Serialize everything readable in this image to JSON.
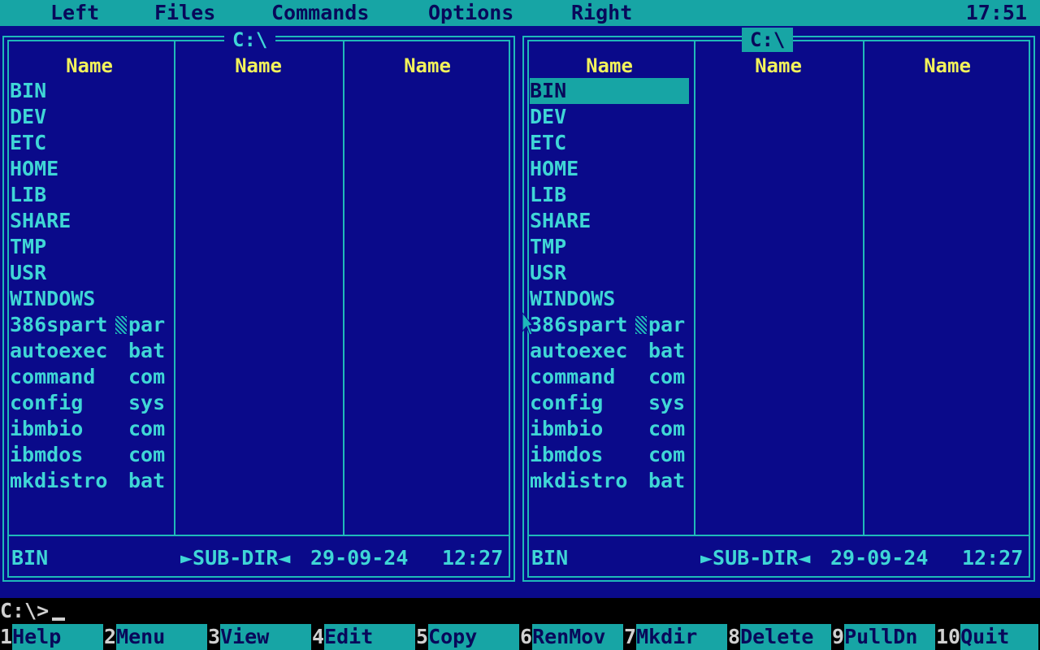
{
  "menu": {
    "items": [
      "Left",
      "Files",
      "Commands",
      "Options",
      "Right"
    ],
    "clock": "17:51"
  },
  "left_panel": {
    "path": "C:\\",
    "column_headers": [
      "Name",
      "Name",
      "Name"
    ],
    "files": [
      {
        "name": "BIN",
        "ext": ""
      },
      {
        "name": "DEV",
        "ext": ""
      },
      {
        "name": "ETC",
        "ext": ""
      },
      {
        "name": "HOME",
        "ext": ""
      },
      {
        "name": "LIB",
        "ext": ""
      },
      {
        "name": "SHARE",
        "ext": ""
      },
      {
        "name": "TMP",
        "ext": ""
      },
      {
        "name": "USR",
        "ext": ""
      },
      {
        "name": "WINDOWS",
        "ext": ""
      },
      {
        "name": "386spart",
        "ext": "par"
      },
      {
        "name": "autoexec",
        "ext": "bat"
      },
      {
        "name": "command",
        "ext": "com"
      },
      {
        "name": "config",
        "ext": "sys"
      },
      {
        "name": "ibmbio",
        "ext": "com"
      },
      {
        "name": "ibmdos",
        "ext": "com"
      },
      {
        "name": "mkdistro",
        "ext": "bat"
      }
    ],
    "status": {
      "name": "BIN",
      "type": "►SUB-DIR◄",
      "date": "29-09-24",
      "time": "12:27"
    }
  },
  "right_panel": {
    "path": "C:\\",
    "column_headers": [
      "Name",
      "Name",
      "Name"
    ],
    "files": [
      {
        "name": "BIN",
        "ext": ""
      },
      {
        "name": "DEV",
        "ext": ""
      },
      {
        "name": "ETC",
        "ext": ""
      },
      {
        "name": "HOME",
        "ext": ""
      },
      {
        "name": "LIB",
        "ext": ""
      },
      {
        "name": "SHARE",
        "ext": ""
      },
      {
        "name": "TMP",
        "ext": ""
      },
      {
        "name": "USR",
        "ext": ""
      },
      {
        "name": "WINDOWS",
        "ext": ""
      },
      {
        "name": "386spart",
        "ext": "par"
      },
      {
        "name": "autoexec",
        "ext": "bat"
      },
      {
        "name": "command",
        "ext": "com"
      },
      {
        "name": "config",
        "ext": "sys"
      },
      {
        "name": "ibmbio",
        "ext": "com"
      },
      {
        "name": "ibmdos",
        "ext": "com"
      },
      {
        "name": "mkdistro",
        "ext": "bat"
      }
    ],
    "selected_index": 0,
    "status": {
      "name": "BIN",
      "type": "►SUB-DIR◄",
      "date": "29-09-24",
      "time": "12:27"
    }
  },
  "command_line": {
    "prompt": "C:\\>"
  },
  "function_keys": [
    {
      "num": "1",
      "label": "Help"
    },
    {
      "num": "2",
      "label": "Menu"
    },
    {
      "num": "3",
      "label": "View"
    },
    {
      "num": "4",
      "label": "Edit"
    },
    {
      "num": "5",
      "label": "Copy"
    },
    {
      "num": "6",
      "label": "RenMov"
    },
    {
      "num": "7",
      "label": "Mkdir"
    },
    {
      "num": "8",
      "label": "Delete"
    },
    {
      "num": "9",
      "label": "PullDn"
    },
    {
      "num": "10",
      "label": "Quit"
    }
  ],
  "colors": {
    "panel_bg": "#0a0a8a",
    "accent_cyan": "#17a5a5",
    "text_cyan": "#3fd6d6",
    "header_yellow": "#f2f25a"
  }
}
